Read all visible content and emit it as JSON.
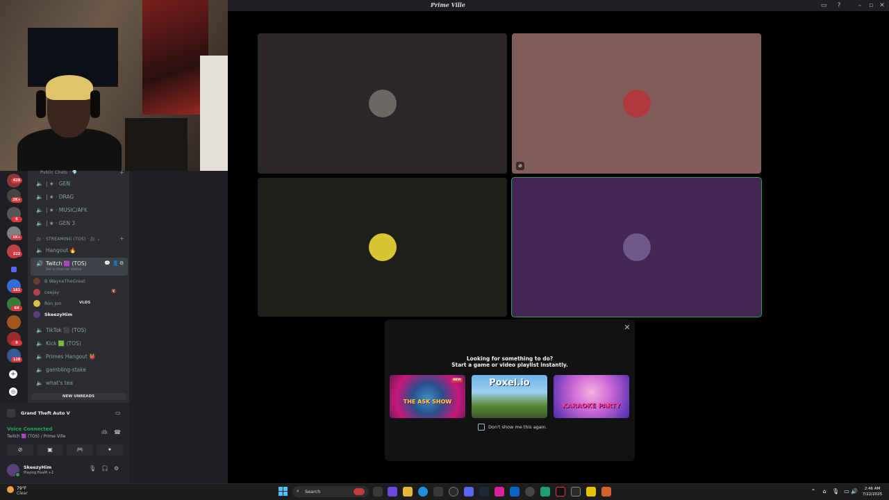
{
  "window": {
    "server_name": "Prime Ville"
  },
  "server_badges": [
    "429",
    "2K+",
    "6",
    "1K+",
    "222",
    "161",
    "64",
    "9",
    "128"
  ],
  "channels": {
    "category_public": "Public Chats",
    "voice": [
      {
        "label": "| ★ · GEN"
      },
      {
        "label": "| ★ · DRAG"
      },
      {
        "label": "| ★ · MUSIC/AFK"
      },
      {
        "label": "| ★ · GEN 3"
      }
    ],
    "category_streaming": "STREAMING (TOS)",
    "hangout": "Hangout 🔥",
    "active_channel": "Twitch 🟪 (TOS)",
    "active_status": "Set a channel status",
    "members": [
      {
        "name": "B WayneTheGreat",
        "color": "#6b3b2a"
      },
      {
        "name": "ceejay",
        "color": "#b2454a"
      },
      {
        "name": "Ron Jon",
        "tag": "VLDS",
        "color": "#d9c34a"
      },
      {
        "name": "SkeezyHim",
        "color": "#5a3f7d"
      }
    ],
    "others": [
      {
        "label": "TikTok ⬛ (TOS)"
      },
      {
        "label": "Kick 🟩 (TOS)"
      },
      {
        "label": "Primes Hangout 👹"
      },
      {
        "label": "gambling-stake"
      },
      {
        "label": "what's tea"
      }
    ],
    "new_unreads": "NEW UNREADS"
  },
  "activity": {
    "game": "Grand Theft Auto V"
  },
  "voice": {
    "status": "Voice Connected",
    "channel": "Twitch 🟪 (TOS) / Prime Ville"
  },
  "user": {
    "name": "SkeezyHim",
    "status": "Playing FiveM +2"
  },
  "tiles": [
    {
      "bg": "#2b2728",
      "avatar": "#6c6763"
    },
    {
      "bg": "#835d5b",
      "avatar": "#b33a3c"
    },
    {
      "bg": "#1d1f1a",
      "avatar": "#d8c532"
    },
    {
      "bg": "#432856",
      "avatar": "#6f5a8a"
    }
  ],
  "shelf": {
    "title": "Looking for something to do?",
    "subtitle": "Start a game or video playlist instantly.",
    "new_badge": "NEW",
    "games": [
      {
        "name": "THE ASK SHOW"
      },
      {
        "name": "Poxel.io"
      },
      {
        "name": "KARAOKE PARTY"
      }
    ],
    "dont_show": "Don't show me this again."
  },
  "taskbar": {
    "weather_temp": "79°F",
    "weather_desc": "Clear",
    "search_placeholder": "Search",
    "time": "2:46 AM",
    "date": "7/22/2025"
  }
}
